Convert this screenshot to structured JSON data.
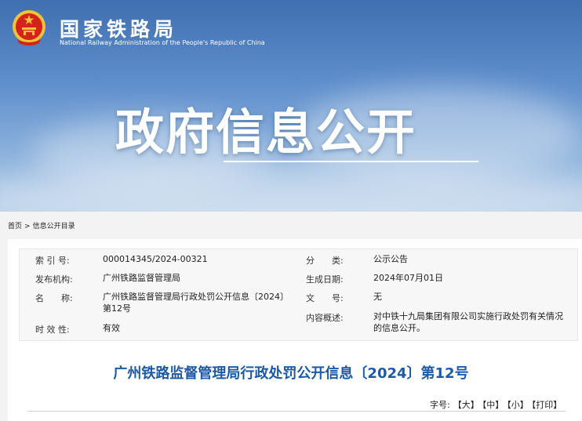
{
  "header": {
    "org_name": "国家铁路局",
    "org_name_en": "National Railway Administration of the People's Republic of China",
    "hero_title": "政府信息公开"
  },
  "breadcrumb": {
    "home": "首页",
    "separator": ">",
    "current": "信息公开目录"
  },
  "meta": {
    "index_label": "索 引 号:",
    "index_value": "000014345/2024-00321",
    "category_label": "分　　类:",
    "category_value": "公示公告",
    "issuer_label": "发布机构:",
    "issuer_value": "广州铁路监督管理局",
    "date_label": "生成日期:",
    "date_value": "2024年07月01日",
    "name_label": "名　　称:",
    "name_value": "广州铁路监督管理局行政处罚公开信息〔2024〕第12号",
    "doc_no_label": "文　　号:",
    "doc_no_value": "无",
    "summary_label": "内容概述:",
    "summary_value": "对中铁十九局集团有限公司实施行政处罚有关情况的信息公开。",
    "validity_label": "时 效 性:",
    "validity_value": "有效"
  },
  "article": {
    "title": "广州铁路监督管理局行政处罚公开信息〔2024〕第12号"
  },
  "font_size": {
    "label": "字号:",
    "large": "【大】",
    "medium": "【中】",
    "small": "【小】",
    "print": "【打印】"
  },
  "colors": {
    "title_blue": "#1c5aa8",
    "banner_blue": "#3f6fb0",
    "emblem_red": "#d4231b",
    "emblem_gold": "#f3c236"
  }
}
